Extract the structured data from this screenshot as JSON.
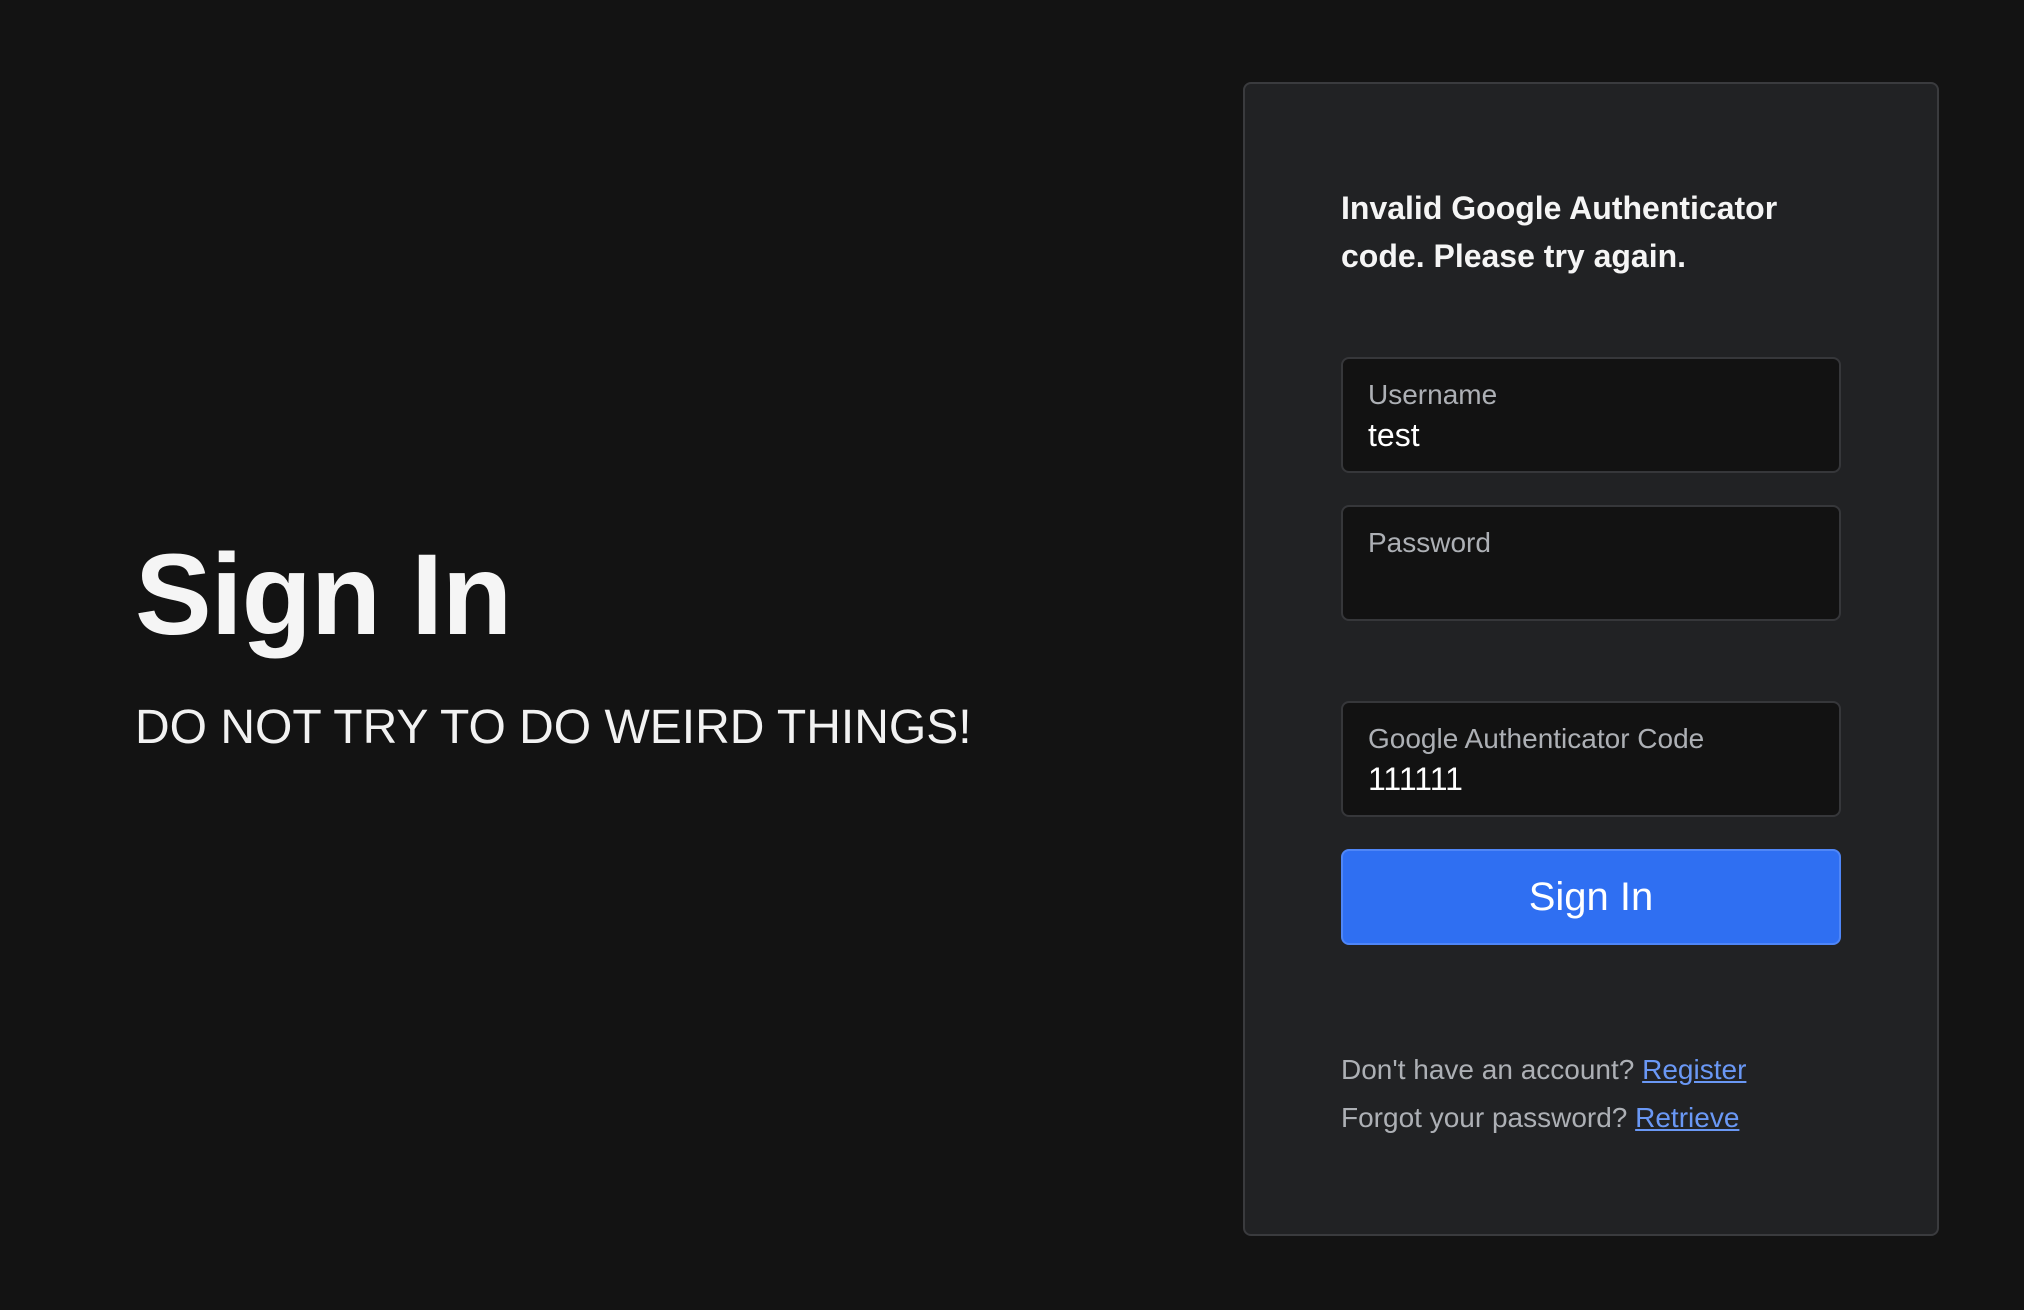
{
  "hero": {
    "title": "Sign In",
    "subtitle": "DO NOT TRY TO DO WEIRD THINGS!"
  },
  "form": {
    "alert": "Invalid Google Authenticator code. Please try again.",
    "username": {
      "label": "Username",
      "value": "test"
    },
    "password": {
      "label": "Password",
      "value": ""
    },
    "code": {
      "label": "Google Authenticator Code",
      "value": "111111"
    },
    "submit_label": "Sign In",
    "register_prompt": "Don't have an account?",
    "register_link": "Register",
    "forgot_prompt": "Forgot your password?",
    "retrieve_link": "Retrieve"
  },
  "colors": {
    "background": "#131313",
    "card": "#212224",
    "primary_button": "#2f6ff2",
    "link": "#6a98f5"
  }
}
